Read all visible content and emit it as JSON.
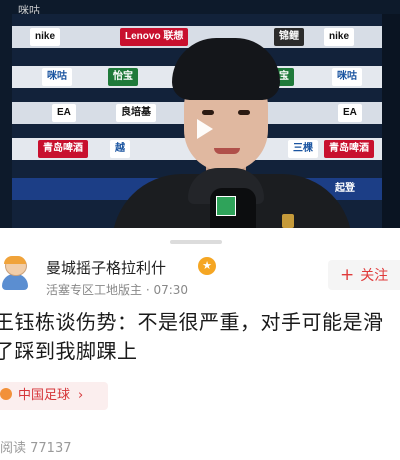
{
  "video": {
    "watermark": "咪咕",
    "ads_row1": [
      "nike",
      "Lenovo 联想",
      "锦鲤",
      "nike"
    ],
    "ads_row2": [
      "咪咕",
      "怡宝",
      "怡宝",
      "咪咕"
    ],
    "ads_row3": [
      "EA",
      "良培基",
      "EA"
    ],
    "ads_row4": [
      "青岛啤酒",
      "越",
      "三棵",
      "青岛啤酒"
    ],
    "ads_row5": [
      "起登"
    ]
  },
  "author": {
    "name": "曼城摇子格拉利什",
    "badge_icon": "tiger-badge-icon",
    "meta": "活塞专区工地版主 · 07:30"
  },
  "follow": {
    "plus": "+",
    "label": "关注"
  },
  "headline": "王钰栋谈伤势：不是很严重，对手可能是滑了踩到我脚踝上",
  "topic": {
    "label": "中国足球",
    "chevron": "›"
  },
  "read_count": "阅读 77137",
  "colors": {
    "accent": "#e03a3a",
    "tag_bg": "#fbeeee",
    "muted": "#888888"
  }
}
